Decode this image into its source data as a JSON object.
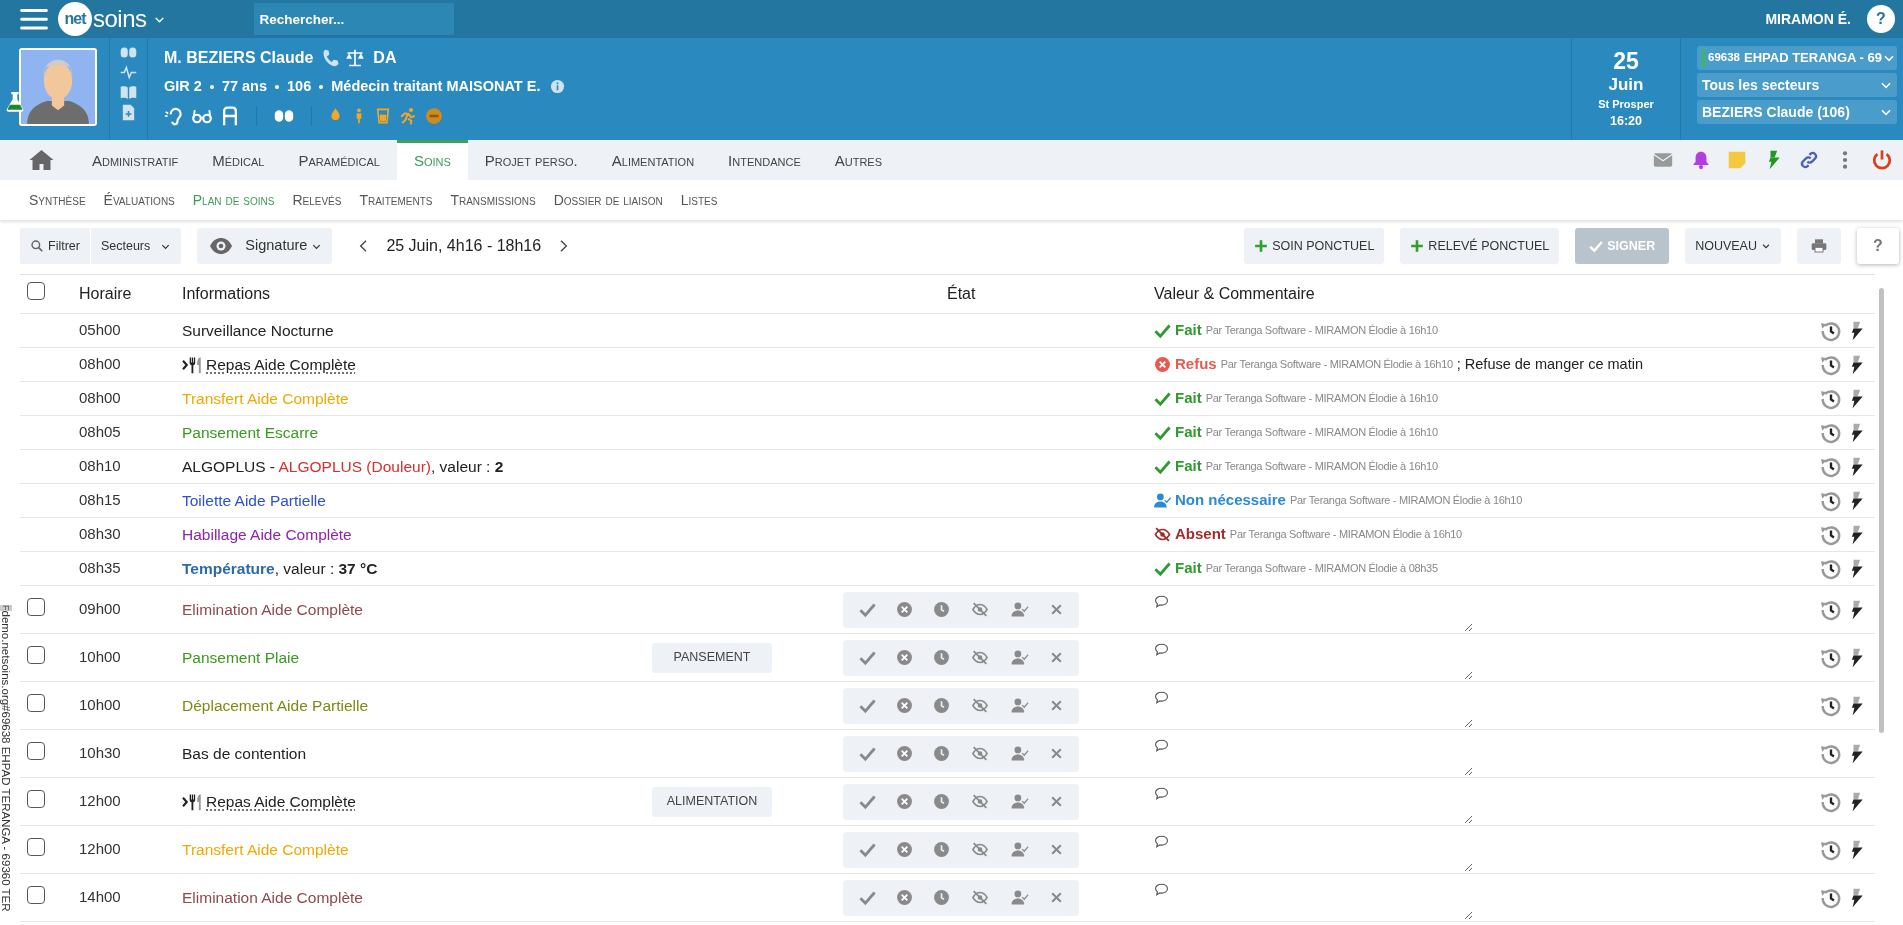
{
  "top_bar": {
    "logo": {
      "mark": "net",
      "text": "soins"
    },
    "search": {
      "placeholder": "Rechercher..."
    },
    "user": "MIRAMON É.",
    "help": "?"
  },
  "patient": {
    "name": "M. BEZIERS Claude",
    "tag": "DA",
    "details": [
      "GIR 2",
      "77 ans",
      "106",
      "Médecin traitant MAISONAT E."
    ]
  },
  "date": {
    "day": "25",
    "month": "Juin",
    "saint": "St Prosper",
    "time": "16:20"
  },
  "selectors": [
    {
      "code": "69638",
      "value": "EHPAD TERANGA - 69"
    },
    {
      "value": "Tous les secteurs"
    },
    {
      "value": "BEZIERS Claude (106)"
    }
  ],
  "tabs": [
    {
      "label": "Administratif",
      "selected": false
    },
    {
      "label": "Médical",
      "selected": false
    },
    {
      "label": "Paramédical",
      "selected": false
    },
    {
      "label": "Soins",
      "selected": true
    },
    {
      "label": "Projet perso.",
      "selected": false
    },
    {
      "label": "Alimentation",
      "selected": false
    },
    {
      "label": "Intendance",
      "selected": false
    },
    {
      "label": "Autres",
      "selected": false
    }
  ],
  "subtabs": [
    {
      "label": "Synthèse",
      "selected": false
    },
    {
      "label": "Évaluations",
      "selected": false
    },
    {
      "label": "Plan de soins",
      "selected": true
    },
    {
      "label": "Relevés",
      "selected": false
    },
    {
      "label": "Traitements",
      "selected": false
    },
    {
      "label": "Transmissions",
      "selected": false
    },
    {
      "label": "Dossier de liaison",
      "selected": false
    },
    {
      "label": "Listes",
      "selected": false
    }
  ],
  "toolbar": {
    "filter": "Filtrer",
    "sectors": "Secteurs",
    "view": "Signature",
    "period": "25 Juin, 4h16 - 18h16",
    "actions": [
      {
        "kind": "add",
        "label": "SOIN PONCTUEL",
        "disabled": false
      },
      {
        "kind": "add",
        "label": "RELEVÉ PONCTUEL",
        "disabled": false
      },
      {
        "kind": "sign",
        "label": "SIGNER",
        "disabled": true
      },
      {
        "kind": "menu",
        "label": "NOUVEAU",
        "disabled": false
      },
      {
        "kind": "print",
        "disabled": false
      },
      {
        "kind": "help",
        "label": "?",
        "disabled": false
      }
    ]
  },
  "table": {
    "select_all_checked": false,
    "columns": [
      "Horaire",
      "Informations",
      "État",
      "Valeur & Commentaire"
    ],
    "rows": [
      {
        "time": "05h00",
        "meal": false,
        "info": [
          {
            "text": "Surveillance Nocturne"
          }
        ],
        "kind": "done",
        "status_label": "Fait",
        "signed": "Par Teranga Software - MIRAMON Élodie à 16h10"
      },
      {
        "time": "08h00",
        "meal": true,
        "info": [
          {
            "text": "Repas Aide Complète"
          }
        ],
        "kind": "refused",
        "status_label": "Refus",
        "signed": "Par Teranga Software - MIRAMON Élodie à 16h10",
        "comment": "; Refuse de manger ce matin"
      },
      {
        "time": "08h00",
        "meal": false,
        "info": [
          {
            "text": "Transfert Aide Complète",
            "color": "#f0a800"
          }
        ],
        "kind": "done",
        "status_label": "Fait",
        "signed": "Par Teranga Software - MIRAMON Élodie à 16h10"
      },
      {
        "time": "08h05",
        "meal": false,
        "info": [
          {
            "text": "Pansement Escarre",
            "color": "#3a9a1e"
          }
        ],
        "kind": "done",
        "status_label": "Fait",
        "signed": "Par Teranga Software - MIRAMON Élodie à 16h10"
      },
      {
        "time": "08h10",
        "meal": false,
        "info": [
          {
            "text": "ALGOPLUS - "
          },
          {
            "text": "ALGOPLUS (Douleur)",
            "color": "#d32f2f"
          },
          {
            "text": ", valeur : **2**"
          }
        ],
        "kind": "done",
        "status_label": "Fait",
        "signed": "Par Teranga Software - MIRAMON Élodie à 16h10"
      },
      {
        "time": "08h15",
        "meal": false,
        "info": [
          {
            "text": "Toilette Aide Partielle",
            "color": "#2d4fd6"
          }
        ],
        "kind": "not_needed",
        "status_label": "Non nécessaire",
        "signed": "Par Teranga Software - MIRAMON Élodie à 16h10"
      },
      {
        "time": "08h30",
        "meal": false,
        "info": [
          {
            "text": "Habillage Aide Complète",
            "color": "#8e24aa"
          }
        ],
        "kind": "absent",
        "status_label": "Absent",
        "signed": "Par Teranga Software - MIRAMON Élodie à 16h10"
      },
      {
        "time": "08h35",
        "meal": false,
        "info": [
          {
            "text": "**Température**",
            "color": "#2d6aa8"
          },
          {
            "text": ", valeur : **37 °C**"
          }
        ],
        "kind": "done",
        "status_label": "Fait",
        "signed": "Par Teranga Software - MIRAMON Élodie à 08h35"
      },
      {
        "time": "09h00",
        "meal": false,
        "info": [
          {
            "text": "Elimination Aide Complète",
            "color": "#8d4a4a"
          }
        ],
        "kind": "pending",
        "checked": false
      },
      {
        "time": "10h00",
        "meal": false,
        "info": [
          {
            "text": "Pansement Plaie",
            "color": "#3a9a1e"
          }
        ],
        "kind": "pending",
        "checked": false,
        "category": "PANSEMENT"
      },
      {
        "time": "10h00",
        "meal": false,
        "info": [
          {
            "text": "Déplacement Aide Partielle",
            "color": "#7d8a10"
          }
        ],
        "kind": "pending",
        "checked": false
      },
      {
        "time": "10h30",
        "meal": false,
        "info": [
          {
            "text": "Bas de contention"
          }
        ],
        "kind": "pending",
        "checked": false
      },
      {
        "time": "12h00",
        "meal": true,
        "info": [
          {
            "text": "Repas Aide Complète"
          }
        ],
        "kind": "pending",
        "checked": false,
        "category": "ALIMENTATION"
      },
      {
        "time": "12h00",
        "meal": false,
        "info": [
          {
            "text": "Transfert Aide Complète",
            "color": "#f0a800"
          }
        ],
        "kind": "pending",
        "checked": false
      },
      {
        "time": "14h00",
        "meal": false,
        "info": [
          {
            "text": "Elimination Aide Complète",
            "color": "#8d4a4a"
          }
        ],
        "kind": "pending",
        "checked": false
      }
    ]
  },
  "side_label": {
    "badge": "F",
    "text": "demo.netsoins.org#69638 EHPAD TERANGA - 69360 TER"
  }
}
